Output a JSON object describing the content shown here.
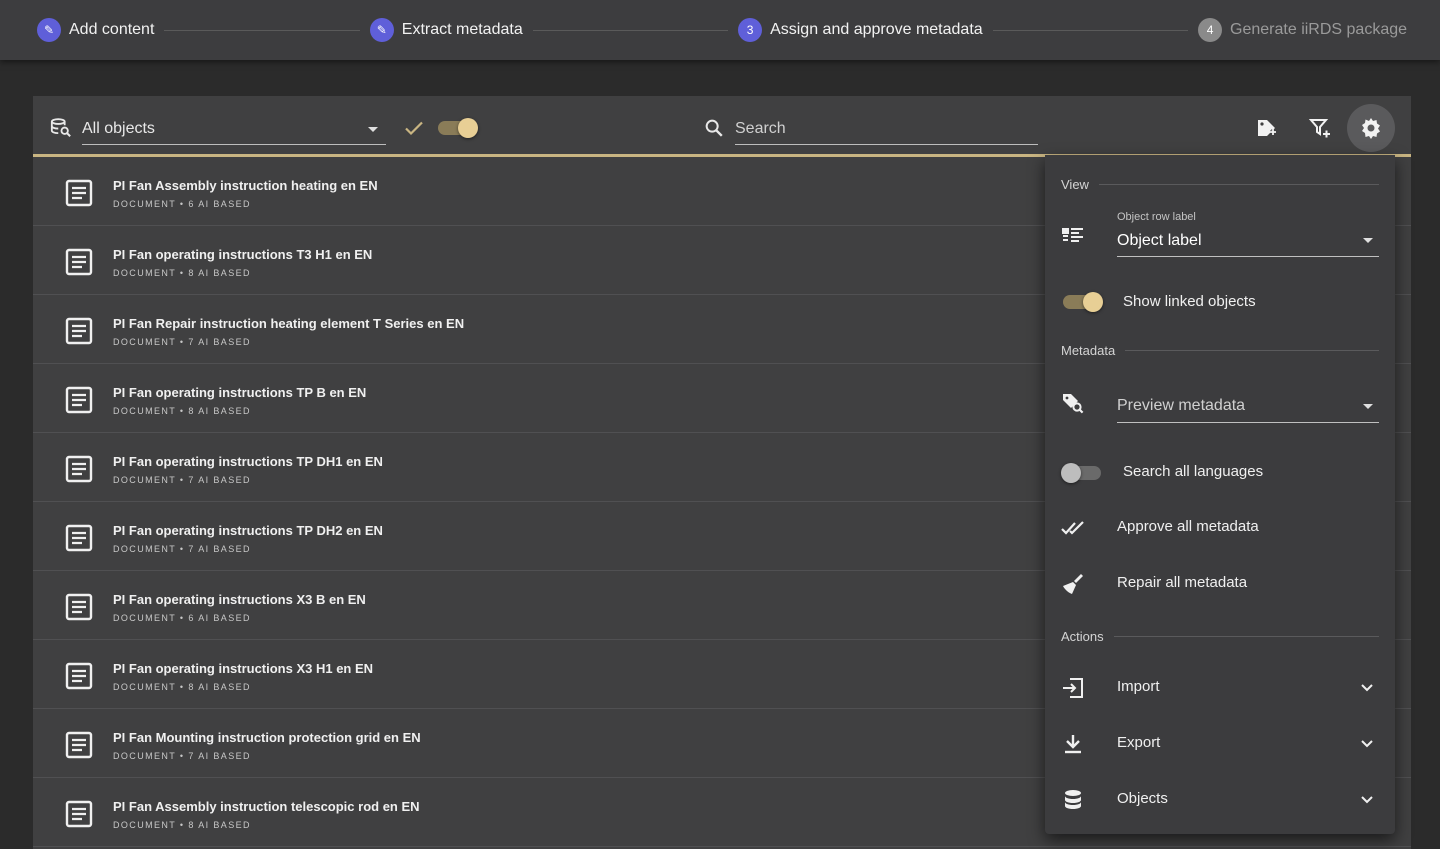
{
  "stepper": {
    "steps": [
      {
        "label": "Add content",
        "badge": "✎",
        "state": "done"
      },
      {
        "label": "Extract metadata",
        "badge": "✎",
        "state": "done"
      },
      {
        "label": "Assign and approve metadata",
        "badge": "3",
        "state": "active"
      },
      {
        "label": "Generate iiRDS package",
        "badge": "4",
        "state": "inactive"
      }
    ]
  },
  "toolbar": {
    "object_filter": "All objects",
    "approved_toggle": true,
    "search_placeholder": "Search"
  },
  "rows": [
    {
      "title": "PI Fan Assembly instruction heating en EN",
      "subtitle": "DOCUMENT • 6 AI BASED"
    },
    {
      "title": "PI Fan operating instructions T3 H1 en EN",
      "subtitle": "DOCUMENT • 8 AI BASED"
    },
    {
      "title": "PI Fan Repair instruction heating element T Series en EN",
      "subtitle": "DOCUMENT • 7 AI BASED"
    },
    {
      "title": "PI Fan operating instructions TP B en EN",
      "subtitle": "DOCUMENT • 8 AI BASED"
    },
    {
      "title": "PI Fan operating instructions TP DH1 en EN",
      "subtitle": "DOCUMENT • 7 AI BASED"
    },
    {
      "title": "PI Fan operating instructions TP DH2 en EN",
      "subtitle": "DOCUMENT • 7 AI BASED"
    },
    {
      "title": "PI Fan operating instructions X3 B en EN",
      "subtitle": "DOCUMENT • 6 AI BASED"
    },
    {
      "title": "PI Fan operating instructions X3 H1 en EN",
      "subtitle": "DOCUMENT • 8 AI BASED"
    },
    {
      "title": "PI Fan Mounting instruction protection grid en EN",
      "subtitle": "DOCUMENT • 7 AI BASED"
    },
    {
      "title": "PI Fan Assembly instruction telescopic rod en EN",
      "subtitle": "DOCUMENT • 8 AI BASED"
    }
  ],
  "panel": {
    "view_heading": "View",
    "row_label_caption": "Object row label",
    "row_label_value": "Object label",
    "show_linked_label": "Show linked objects",
    "show_linked_on": true,
    "metadata_heading": "Metadata",
    "preview_metadata": "Preview metadata",
    "search_all_label": "Search all languages",
    "search_all_on": false,
    "approve_all": "Approve all metadata",
    "repair_all": "Repair all metadata",
    "actions_heading": "Actions",
    "import": "Import",
    "export": "Export",
    "objects": "Objects"
  },
  "colors": {
    "accent": "#c9b582",
    "step_active": "#5f5fd9",
    "background": "#2b2b2b",
    "card": "#404041"
  }
}
